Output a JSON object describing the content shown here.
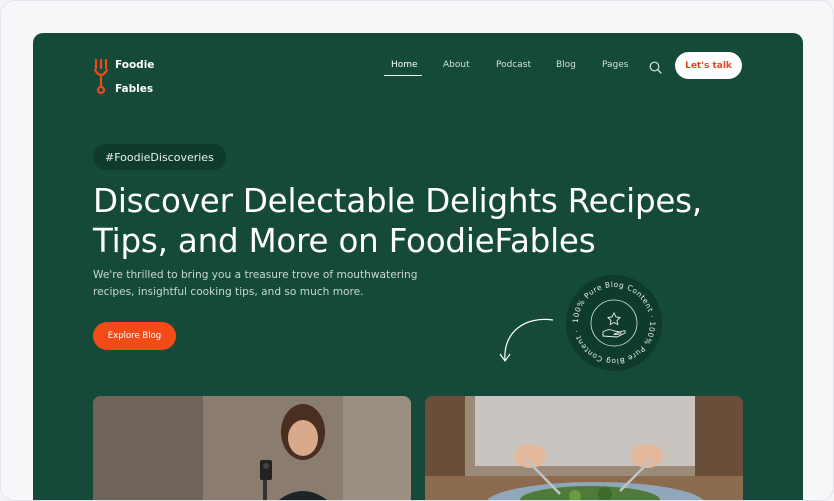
{
  "brand": {
    "name_line1": "Foodie",
    "name_line2": "Fables",
    "accent": "#f24b18",
    "bg": "#15493a"
  },
  "nav": {
    "items": [
      {
        "label": "Home",
        "active": true
      },
      {
        "label": "About",
        "active": false
      },
      {
        "label": "Podcast",
        "active": false
      },
      {
        "label": "Blog",
        "active": false
      },
      {
        "label": "Pages",
        "active": false
      }
    ],
    "search_icon": "search-icon",
    "cta_label": "Let's talk"
  },
  "hero": {
    "tag": "#FoodieDiscoveries",
    "headline_line1": "Discover Delectable Delights Recipes,",
    "headline_line2": "Tips, and More on FoodieFables",
    "subtext_line1": "We're thrilled to bring you a treasure trove of mouthwatering",
    "subtext_line2": "recipes, insightful cooking tips, and so much more.",
    "button_label": "Explore Blog",
    "badge_text": "100% Pure Blog Content · 100% Pure Blog Content ·"
  },
  "cards": [
    {
      "image": "woman-filming-cooking-photo"
    },
    {
      "image": "person-eating-salad-photo"
    }
  ]
}
